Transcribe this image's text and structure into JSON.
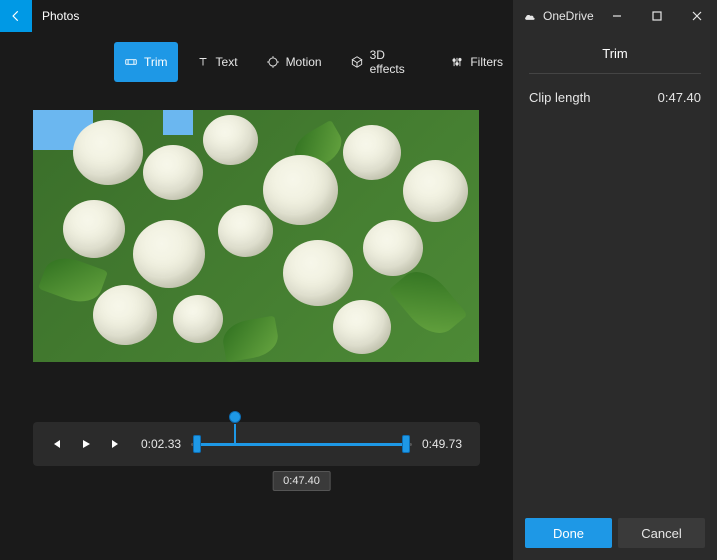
{
  "app": {
    "title": "Photos"
  },
  "cloud": {
    "label": "OneDrive"
  },
  "toolbar": {
    "items": [
      {
        "id": "trim",
        "label": "Trim",
        "active": true
      },
      {
        "id": "text",
        "label": "Text",
        "active": false
      },
      {
        "id": "motion",
        "label": "Motion",
        "active": false
      },
      {
        "id": "3d",
        "label": "3D effects",
        "active": false
      },
      {
        "id": "filters",
        "label": "Filters",
        "active": false
      }
    ]
  },
  "playback": {
    "start_time": "0:02.33",
    "end_time": "0:49.73",
    "selection_duration": "0:47.40",
    "playhead_percent": 20
  },
  "side": {
    "title": "Trim",
    "clip_length_label": "Clip length",
    "clip_length_value": "0:47.40",
    "done_label": "Done",
    "cancel_label": "Cancel"
  },
  "colors": {
    "accent": "#1e98e6"
  }
}
